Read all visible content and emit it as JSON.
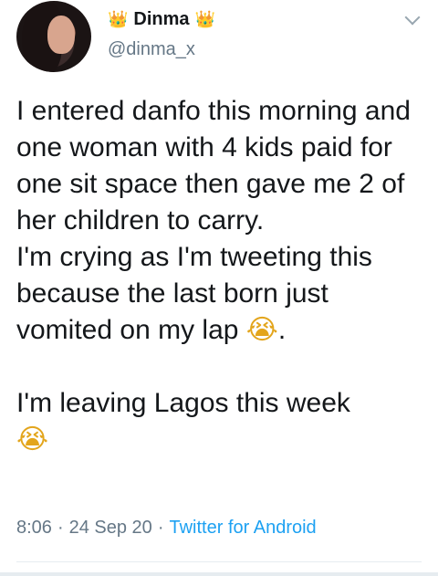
{
  "user": {
    "display_name": "Dinma",
    "crown_emoji": "👑",
    "handle": "@dinma_x"
  },
  "tweet": {
    "para1": "I entered danfo this morning and one woman with 4 kids paid for one sit space then gave me 2 of her children to carry.",
    "para2_text": "I'm crying as I'm tweeting this because the last born just vomited on my lap ",
    "para2_emoji": "😭",
    "para2_end": ".",
    "para3_text": "I'm leaving Lagos this week",
    "para3_emoji": "😭"
  },
  "meta": {
    "time": "8:06",
    "sep1": "·",
    "date": "24 Sep 20",
    "sep2": "·",
    "source": "Twitter for Android"
  },
  "colors": {
    "text": "#14171a",
    "secondary": "#657786",
    "link": "#1da1f2",
    "divider": "#e6ecf0"
  },
  "icons": {
    "more": "chevron-down-icon"
  }
}
